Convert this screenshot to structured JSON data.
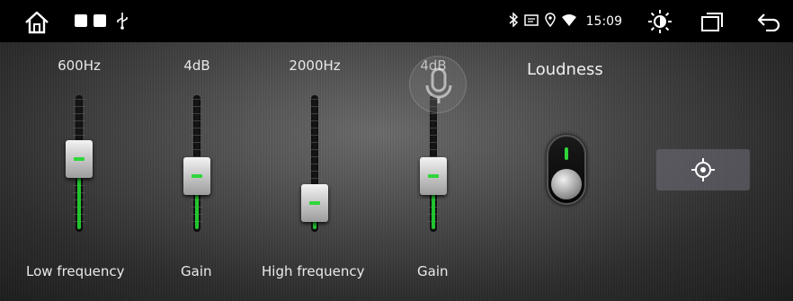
{
  "status_bar": {
    "time": "15:09",
    "icons": [
      "home-icon",
      "app-square-icon",
      "app-square-icon",
      "usb-icon",
      "bluetooth-icon",
      "cast-icon",
      "location-icon",
      "wifi-icon",
      "brightness-icon",
      "recent-apps-icon",
      "back-icon"
    ]
  },
  "equalizer": {
    "low_frequency": {
      "value": "600Hz",
      "label": "Low frequency",
      "level": 0.55
    },
    "low_gain": {
      "value": "4dB",
      "label": "Gain",
      "level": 0.37
    },
    "high_frequency": {
      "value": "2000Hz",
      "label": "High frequency",
      "level": 0.1
    },
    "high_gain": {
      "value": "4dB",
      "label": "Gain",
      "level": 0.37
    }
  },
  "loudness": {
    "title": "Loudness",
    "enabled": true
  },
  "colors": {
    "accent_green": "#2fd63b",
    "background": "#000000"
  }
}
